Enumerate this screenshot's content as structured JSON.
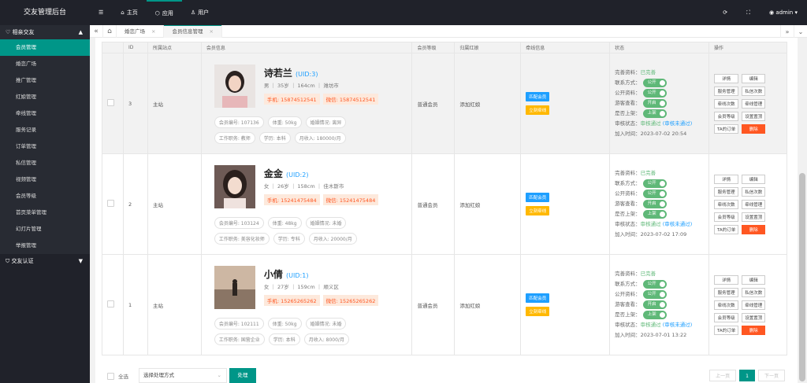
{
  "brand": "交友管理后台",
  "topnav": [
    {
      "icon": "menu-icon",
      "label": ""
    },
    {
      "icon": "home-icon",
      "label": "主页"
    },
    {
      "icon": "app-icon",
      "label": "应用"
    },
    {
      "icon": "user-icon",
      "label": "用户"
    }
  ],
  "topright": {
    "refresh": "⟳",
    "full": "⛶",
    "user": "admin"
  },
  "sidebar": {
    "group1": "相亲交友",
    "items": [
      "会员管理",
      "婚恋广场",
      "推广管理",
      "红娘管理",
      "牵线管理",
      "服务记录",
      "订单管理",
      "私信管理",
      "视频管理",
      "会员等级",
      "首页菜单管理",
      "幻灯片管理",
      "举报管理"
    ],
    "group2": "交友认证"
  },
  "tabs": [
    "婚恋广场",
    "会员信息管理"
  ],
  "table": {
    "headers": [
      "",
      "ID",
      "所属站点",
      "会员信息",
      "会员等级",
      "归属红娘",
      "牵线信息",
      "状态",
      "操作"
    ],
    "rows": [
      {
        "id": "3",
        "site": "主站",
        "name": "诗若兰",
        "uid": "(UID:3)",
        "meta": "男 ｜ 35岁 ｜ 164cm ｜ 潍坊市",
        "phone": "手机: 15874512541",
        "wechat": "微信: 15874512541",
        "tags1": [
          "会员编号: 107136",
          "体重: 50kg",
          "婚姻情况: 离异"
        ],
        "tags2": [
          "工作职务: 教师",
          "学历: 本科",
          "月收入: 180000/月"
        ],
        "level": "普通会员",
        "matchmaker": "添加红娘",
        "btn1": "匹配会员",
        "btn2": "立刻牵线",
        "s_complete": "已完善",
        "s_time": "2023-07-02 20:54",
        "av": "a"
      },
      {
        "id": "2",
        "site": "主站",
        "name": "金金",
        "uid": "(UID:2)",
        "meta": "女 ｜ 26岁 ｜ 158cm ｜ 佳木斯市",
        "phone": "手机: 15241475484",
        "wechat": "微信: 15241475484",
        "tags1": [
          "会员编号: 103124",
          "体重: 48kg",
          "婚姻情况: 未婚"
        ],
        "tags2": [
          "工作职务: 美容化妆师",
          "学历: 专科",
          "月收入: 20000/月"
        ],
        "level": "普通会员",
        "matchmaker": "添加红娘",
        "btn1": "匹配会员",
        "btn2": "立刻牵线",
        "s_complete": "已完善",
        "s_time": "2023-07-02 17:09",
        "av": "b"
      },
      {
        "id": "1",
        "site": "主站",
        "name": "小倩",
        "uid": "(UID:1)",
        "meta": "女 ｜ 27岁 ｜ 159cm ｜ 顺义区",
        "phone": "手机: 15265265262",
        "wechat": "微信: 15265265262",
        "tags1": [
          "会员编号: 102111",
          "体重: 50kg",
          "婚姻情况: 未婚"
        ],
        "tags2": [
          "工作职务: 国营企业",
          "学历: 本科",
          "月收入: 8000/月"
        ],
        "level": "普通会员",
        "matchmaker": "添加红娘",
        "btn1": "匹配会员",
        "btn2": "立刻牵线",
        "s_complete": "已完善",
        "s_time": "2023-07-01 13:22",
        "av": "c"
      }
    ]
  },
  "status_labels": {
    "complete": "完善资料：",
    "contact": "联系方式：",
    "info": "公开资料：",
    "guest": "游客查看：",
    "shelf": "是否上架：",
    "audit": "审核状态：",
    "added": "加入时间："
  },
  "status_values": {
    "public": "公开",
    "open": "开启",
    "up": "上架",
    "passed": "审核通过",
    "unpassed": "(审核未通过)"
  },
  "ops": [
    "详情",
    "编辑",
    "服务管理",
    "私信次数",
    "牵线次数",
    "牵线管理",
    "会员等级",
    "设置置顶",
    "TA的订单",
    "删除"
  ],
  "footer": {
    "select_all": "全选",
    "placeholder": "选择处理方式",
    "submit": "处理",
    "prev": "上一页",
    "page": "1",
    "next": "下一页"
  }
}
